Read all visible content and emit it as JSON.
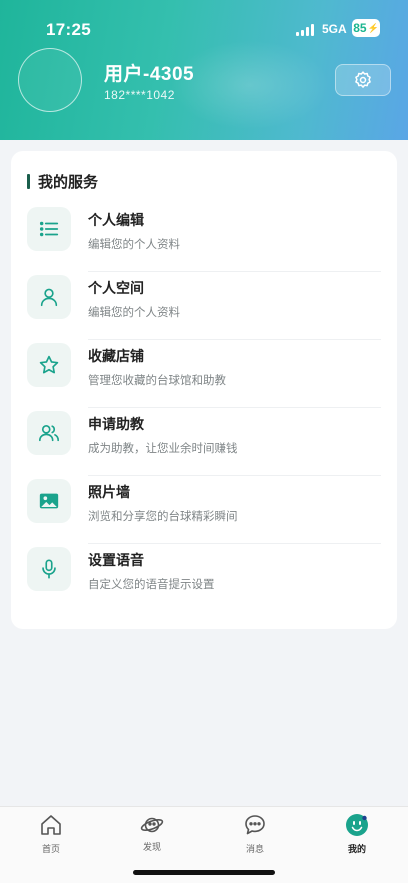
{
  "status_bar": {
    "time": "17:25",
    "network": "5GA",
    "battery": "85"
  },
  "profile": {
    "username": "用户-4305",
    "phone": "182****1042"
  },
  "services": {
    "title": "我的服务",
    "items": [
      {
        "icon": "list-icon",
        "title": "个人编辑",
        "desc": "编辑您的个人资料"
      },
      {
        "icon": "person-icon",
        "title": "个人空间",
        "desc": "编辑您的个人资料"
      },
      {
        "icon": "star-icon",
        "title": "收藏店铺",
        "desc": "管理您收藏的台球馆和助教"
      },
      {
        "icon": "users-icon",
        "title": "申请助教",
        "desc": "成为助教，让您业余时间赚钱"
      },
      {
        "icon": "image-icon",
        "title": "照片墙",
        "desc": "浏览和分享您的台球精彩瞬间"
      },
      {
        "icon": "microphone-icon",
        "title": "设置语音",
        "desc": "自定义您的语音提示设置"
      }
    ]
  },
  "tabbar": {
    "tabs": [
      {
        "icon": "home-icon",
        "label": "首页",
        "active": false
      },
      {
        "icon": "planet-icon",
        "label": "发现",
        "active": false
      },
      {
        "icon": "chat-icon",
        "label": "消息",
        "active": false
      },
      {
        "icon": "profile-face-icon",
        "label": "我的",
        "active": true
      }
    ]
  },
  "colors": {
    "accent": "#1aa38c",
    "header_gradient_start": "#1fb59b",
    "header_gradient_end": "#5aa6e6",
    "section_bar": "#1a5e4c",
    "icon_bg": "#eef5f3"
  }
}
